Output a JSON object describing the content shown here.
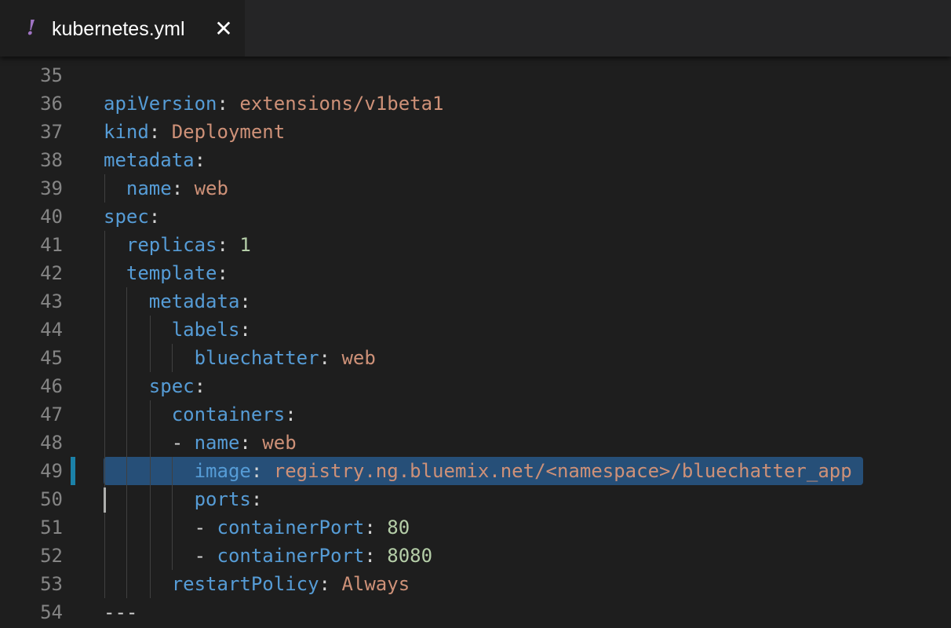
{
  "tab": {
    "icon": "yaml-exclamation-icon",
    "icon_glyph": "!",
    "title": "kubernetes.yml",
    "close_glyph": "✕"
  },
  "colors": {
    "key": "#569cd6",
    "string": "#ce9178",
    "number": "#b5cea8",
    "selection": "#264f78",
    "line_number": "#858585",
    "background": "#1e1e1e"
  },
  "editor": {
    "selected_line": "49",
    "lines": [
      {
        "num": "35",
        "tokens": []
      },
      {
        "num": "36",
        "tokens": [
          {
            "t": "apiVersion",
            "c": "k"
          },
          {
            "t": ": ",
            "c": "p"
          },
          {
            "t": "extensions/v1beta1",
            "c": "s"
          }
        ]
      },
      {
        "num": "37",
        "tokens": [
          {
            "t": "kind",
            "c": "k"
          },
          {
            "t": ": ",
            "c": "p"
          },
          {
            "t": "Deployment",
            "c": "s"
          }
        ]
      },
      {
        "num": "38",
        "tokens": [
          {
            "t": "metadata",
            "c": "k"
          },
          {
            "t": ":",
            "c": "p"
          }
        ]
      },
      {
        "num": "39",
        "tokens": [
          {
            "t": "  ",
            "c": "p"
          },
          {
            "t": "name",
            "c": "k"
          },
          {
            "t": ": ",
            "c": "p"
          },
          {
            "t": "web",
            "c": "s"
          }
        ]
      },
      {
        "num": "40",
        "tokens": [
          {
            "t": "spec",
            "c": "k"
          },
          {
            "t": ":",
            "c": "p"
          }
        ]
      },
      {
        "num": "41",
        "tokens": [
          {
            "t": "  ",
            "c": "p"
          },
          {
            "t": "replicas",
            "c": "k"
          },
          {
            "t": ": ",
            "c": "p"
          },
          {
            "t": "1",
            "c": "n"
          }
        ]
      },
      {
        "num": "42",
        "tokens": [
          {
            "t": "  ",
            "c": "p"
          },
          {
            "t": "template",
            "c": "k"
          },
          {
            "t": ":",
            "c": "p"
          }
        ]
      },
      {
        "num": "43",
        "tokens": [
          {
            "t": "    ",
            "c": "p"
          },
          {
            "t": "metadata",
            "c": "k"
          },
          {
            "t": ":",
            "c": "p"
          }
        ]
      },
      {
        "num": "44",
        "tokens": [
          {
            "t": "      ",
            "c": "p"
          },
          {
            "t": "labels",
            "c": "k"
          },
          {
            "t": ":",
            "c": "p"
          }
        ]
      },
      {
        "num": "45",
        "tokens": [
          {
            "t": "        ",
            "c": "p"
          },
          {
            "t": "bluechatter",
            "c": "k"
          },
          {
            "t": ": ",
            "c": "p"
          },
          {
            "t": "web",
            "c": "s"
          }
        ]
      },
      {
        "num": "46",
        "tokens": [
          {
            "t": "    ",
            "c": "p"
          },
          {
            "t": "spec",
            "c": "k"
          },
          {
            "t": ":",
            "c": "p"
          }
        ]
      },
      {
        "num": "47",
        "tokens": [
          {
            "t": "      ",
            "c": "p"
          },
          {
            "t": "containers",
            "c": "k"
          },
          {
            "t": ":",
            "c": "p"
          }
        ]
      },
      {
        "num": "48",
        "tokens": [
          {
            "t": "      - ",
            "c": "p"
          },
          {
            "t": "name",
            "c": "k"
          },
          {
            "t": ": ",
            "c": "p"
          },
          {
            "t": "web",
            "c": "s"
          }
        ]
      },
      {
        "num": "49",
        "tokens": [
          {
            "t": "        ",
            "c": "p"
          },
          {
            "t": "image",
            "c": "k"
          },
          {
            "t": ": ",
            "c": "p"
          },
          {
            "t": "registry.ng.bluemix.net/<namespace>/bluechatter_app",
            "c": "s"
          }
        ]
      },
      {
        "num": "50",
        "tokens": [
          {
            "t": "        ",
            "c": "p"
          },
          {
            "t": "ports",
            "c": "k"
          },
          {
            "t": ":",
            "c": "p"
          }
        ]
      },
      {
        "num": "51",
        "tokens": [
          {
            "t": "        - ",
            "c": "p"
          },
          {
            "t": "containerPort",
            "c": "k"
          },
          {
            "t": ": ",
            "c": "p"
          },
          {
            "t": "80",
            "c": "n"
          }
        ]
      },
      {
        "num": "52",
        "tokens": [
          {
            "t": "        - ",
            "c": "p"
          },
          {
            "t": "containerPort",
            "c": "k"
          },
          {
            "t": ": ",
            "c": "p"
          },
          {
            "t": "8080",
            "c": "n"
          }
        ]
      },
      {
        "num": "53",
        "tokens": [
          {
            "t": "      ",
            "c": "p"
          },
          {
            "t": "restartPolicy",
            "c": "k"
          },
          {
            "t": ": ",
            "c": "p"
          },
          {
            "t": "Always",
            "c": "s"
          }
        ]
      },
      {
        "num": "54",
        "tokens": [
          {
            "t": "---",
            "c": "p"
          }
        ]
      }
    ]
  }
}
